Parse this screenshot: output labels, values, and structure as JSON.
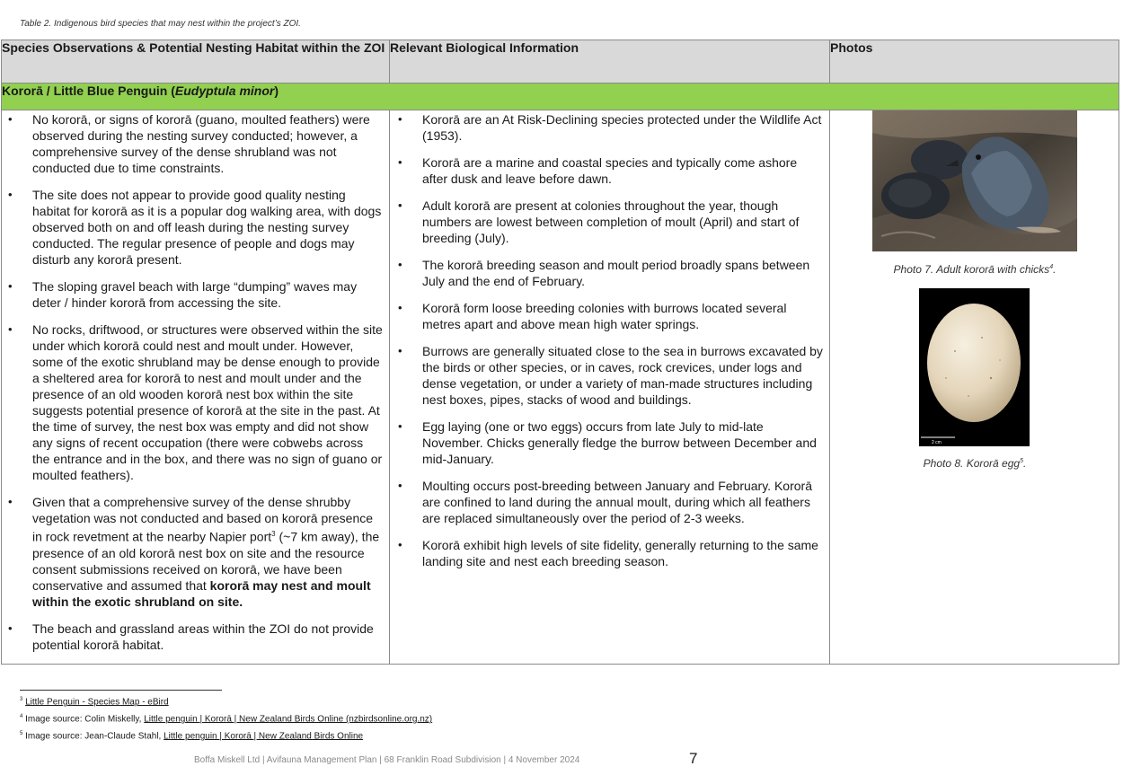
{
  "caption": "Table 2. Indigenous bird species that may nest within the project’s ZOI.",
  "table": {
    "headers": [
      "Species Observations & Potential Nesting Habitat within the ZOI",
      "Relevant Biological Information",
      "Photos"
    ],
    "species_row": {
      "prefix": "Kororā / Little Blue Penguin (",
      "scientific": "Eudyptula minor",
      "suffix": ")"
    },
    "observations": [
      "No kororā, or signs of kororā (guano, moulted feathers) were observed during the nesting survey conducted; however, a comprehensive survey of the dense shrubland was not conducted due to time constraints.",
      "The site does not appear to provide good quality nesting habitat for kororā as it is a popular dog walking area, with dogs observed both on and off leash during the nesting survey conducted. The regular presence of people and dogs may disturb any kororā present.",
      "The sloping gravel beach with large “dumping” waves may deter / hinder kororā from accessing the site.",
      "No rocks, driftwood, or structures were observed within the site under which kororā could nest and moult under. However, some of the exotic shrubland may be dense enough to provide a sheltered area for kororā to nest and moult under and the presence of an old wooden kororā nest box within the site suggests potential presence of kororā at the site in the past. At the time of survey, the nest box was empty and did not show any signs of recent occupation (there were cobwebs across the entrance and in the box, and there was no sign of guano or moulted feathers)."
    ],
    "observation_5": {
      "part1": "Given that a comprehensive survey of the dense shrubby vegetation was not conducted and based on kororā presence in rock revetment at the nearby Napier port",
      "ref": "3",
      "part2": " (~7 km away), the presence of an old kororā nest box on site and the resource consent submissions received on kororā, we have been conservative and assumed that ",
      "bold": "kororā may nest and moult within the exotic shrubland on site."
    },
    "observation_6": "The beach and grassland areas within the ZOI do not provide potential kororā habitat.",
    "biology": [
      "Kororā are an At Risk-Declining species protected under the Wildlife Act (1953).",
      "Kororā are a marine and coastal species and typically come ashore after dusk and leave before dawn.",
      "Adult kororā are present at colonies throughout the year, though numbers are lowest between completion of moult (April) and start of breeding (July).",
      "The kororā breeding season and moult period broadly spans between July and the end of February.",
      "Kororā form loose breeding colonies with burrows located several metres apart and above mean high water springs.",
      "Burrows are generally situated close to the sea in burrows excavated by the birds or other species, or in caves, rock crevices, under logs and dense vegetation, or under a variety of man-made structures including nest boxes, pipes, stacks of wood and buildings.",
      "Egg laying (one or two eggs) occurs from late July to mid-late November. Chicks generally fledge the burrow between December and mid-January.",
      "Moulting occurs post-breeding between January and February. Kororā are confined to land during the annual moult, during which all feathers are replaced simultaneously over the period of 2-3 weeks.",
      "Kororā exhibit high levels of site fidelity, generally returning to the same landing site and nest each breeding season."
    ],
    "photos": {
      "photo7_caption": "Photo 7. Adult kororā with chicks",
      "photo7_ref": "4",
      "photo7_period": ".",
      "photo8_caption": "Photo 8. Kororā egg",
      "photo8_ref": "5",
      "photo8_period": ".",
      "scale_label": "2 cm"
    }
  },
  "footnotes": {
    "fn3": {
      "num": "3",
      "link": "Little Penguin - Species Map - eBird"
    },
    "fn4": {
      "num": "4",
      "prefix": "Image source: Colin Miskelly, ",
      "link": "Little penguin | Kororā | New Zealand Birds Online (nzbirdsonline.org.nz)"
    },
    "fn5": {
      "num": "5",
      "prefix": "Image source: Jean-Claude Stahl, ",
      "link": "Little penguin | Kororā | New Zealand Birds Online"
    }
  },
  "footer": "Boffa Miskell Ltd | Avifauna Management Plan | 68 Franklin Road Subdivision | 4 November 2024",
  "page_number": "7"
}
